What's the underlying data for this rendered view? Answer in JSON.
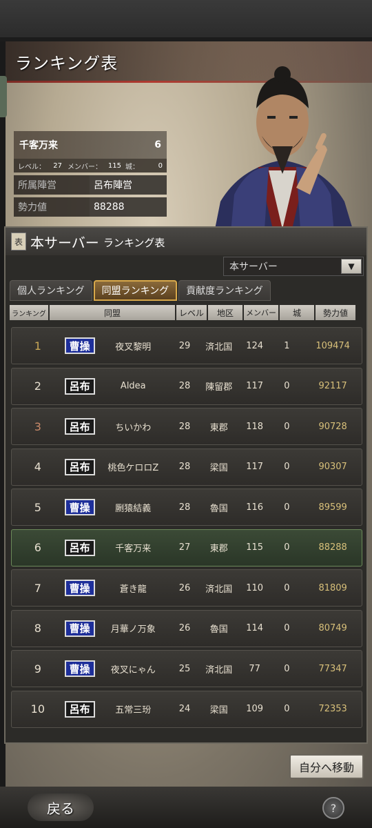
{
  "header": {
    "title": "ランキング表"
  },
  "player": {
    "name": "千客万来",
    "rank": "6",
    "level_label": "レベル：",
    "level": "27",
    "members_label": "メンバー：",
    "members": "115",
    "castles_label": "城：",
    "castles": "0",
    "faction_label": "所属陣営",
    "faction": "呂布陣営",
    "power_label": "勢力値",
    "power": "88288"
  },
  "panel": {
    "seal": "表",
    "title_main": "本サーバー",
    "title_sub": "ランキング表",
    "server_select": "本サーバー",
    "tabs": [
      "個人ランキング",
      "同盟ランキング",
      "貢献度ランキング"
    ],
    "active_tab": 1,
    "columns": [
      "ランキング",
      "同盟",
      "レベル",
      "地区",
      "メンバー",
      "城",
      "勢力値"
    ]
  },
  "rows": [
    {
      "rank": "1",
      "faction": "曹操",
      "faction_color": "#1e2f9a",
      "name": "夜叉黎明",
      "level": "29",
      "region": "済北国",
      "members": "124",
      "castles": "1",
      "power": "109474"
    },
    {
      "rank": "2",
      "faction": "呂布",
      "faction_color": "#1a1a1a",
      "name": "Aldea",
      "level": "28",
      "region": "陳留郡",
      "members": "117",
      "castles": "0",
      "power": "92117"
    },
    {
      "rank": "3",
      "faction": "呂布",
      "faction_color": "#1a1a1a",
      "name": "ちいかわ",
      "level": "28",
      "region": "東郡",
      "members": "118",
      "castles": "0",
      "power": "90728"
    },
    {
      "rank": "4",
      "faction": "呂布",
      "faction_color": "#1a1a1a",
      "name": "桃色ケロロZ",
      "level": "28",
      "region": "梁国",
      "members": "117",
      "castles": "0",
      "power": "90307"
    },
    {
      "rank": "5",
      "faction": "曹操",
      "faction_color": "#1e2f9a",
      "name": "劂猿結義",
      "level": "28",
      "region": "魯国",
      "members": "116",
      "castles": "0",
      "power": "89599"
    },
    {
      "rank": "6",
      "faction": "呂布",
      "faction_color": "#1a1a1a",
      "name": "千客万来",
      "level": "27",
      "region": "東郡",
      "members": "115",
      "castles": "0",
      "power": "88288"
    },
    {
      "rank": "7",
      "faction": "曹操",
      "faction_color": "#1e2f9a",
      "name": "蒼き龍",
      "level": "26",
      "region": "済北国",
      "members": "110",
      "castles": "0",
      "power": "81809"
    },
    {
      "rank": "8",
      "faction": "曹操",
      "faction_color": "#1e2f9a",
      "name": "月華ノ万象",
      "level": "26",
      "region": "魯国",
      "members": "114",
      "castles": "0",
      "power": "80749"
    },
    {
      "rank": "9",
      "faction": "曹操",
      "faction_color": "#1e2f9a",
      "name": "夜叉にゃん",
      "level": "25",
      "region": "済北国",
      "members": "77",
      "castles": "0",
      "power": "77347"
    },
    {
      "rank": "10",
      "faction": "呂布",
      "faction_color": "#1a1a1a",
      "name": "五常三玢",
      "level": "24",
      "region": "梁国",
      "members": "109",
      "castles": "0",
      "power": "72353"
    }
  ],
  "buttons": {
    "move_self": "自分へ移動",
    "back": "戻る",
    "help": "?"
  }
}
